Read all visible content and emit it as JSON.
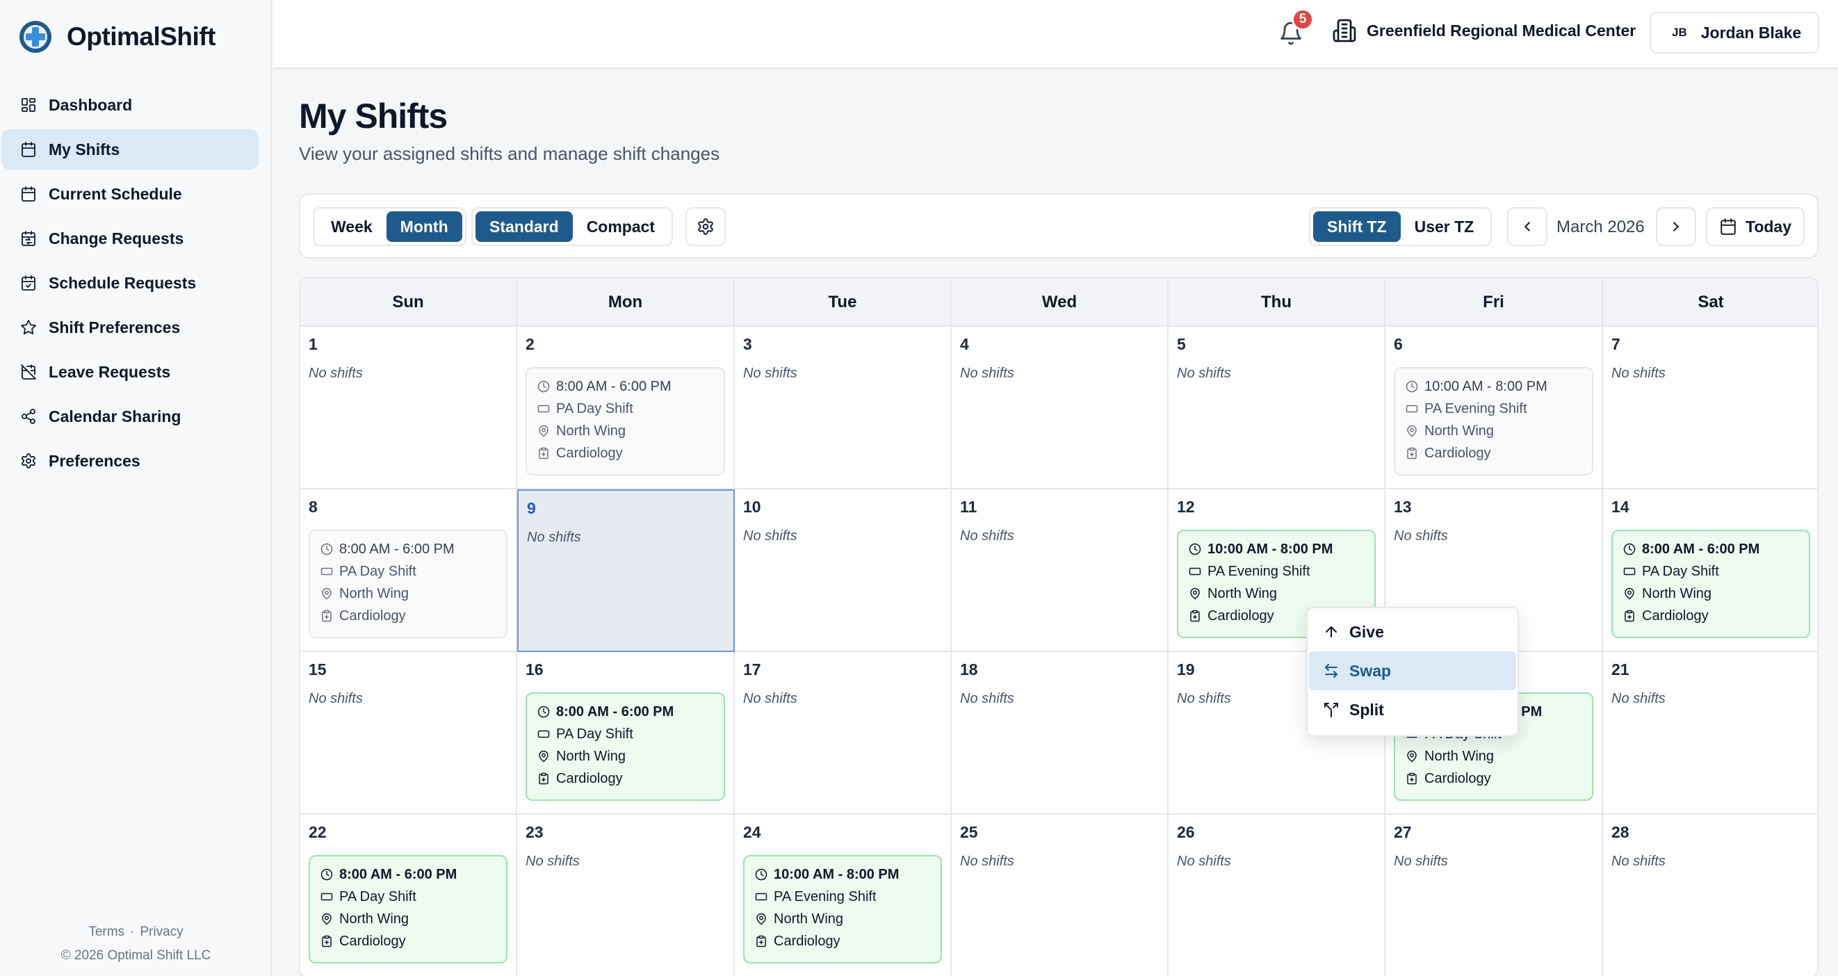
{
  "app": {
    "name": "OptimalShift"
  },
  "colors": {
    "accent": "#1f5a8c",
    "badge": "#e04545",
    "future_shift_bg": "#edfbf0",
    "future_shift_border": "#9ee2b0",
    "today_bg": "#e6ebf3"
  },
  "sidebar": {
    "items": [
      {
        "label": "Dashboard",
        "icon": "dashboard-icon",
        "active": false
      },
      {
        "label": "My Shifts",
        "icon": "calendar-icon",
        "active": true
      },
      {
        "label": "Current Schedule",
        "icon": "calendar-icon",
        "active": false
      },
      {
        "label": "Change Requests",
        "icon": "calendar-swap-icon",
        "active": false
      },
      {
        "label": "Schedule Requests",
        "icon": "calendar-check-icon",
        "active": false
      },
      {
        "label": "Shift Preferences",
        "icon": "star-icon",
        "active": false
      },
      {
        "label": "Leave Requests",
        "icon": "calendar-off-icon",
        "active": false
      },
      {
        "label": "Calendar Sharing",
        "icon": "share-icon",
        "active": false
      },
      {
        "label": "Preferences",
        "icon": "gear-icon",
        "active": false
      }
    ],
    "footer": {
      "terms": "Terms",
      "privacy": "Privacy",
      "separator": "·",
      "copyright": "© 2026 Optimal Shift LLC"
    }
  },
  "topbar": {
    "notifications": "5",
    "organization": "Greenfield Regional Medical Center",
    "user": {
      "initials": "JB",
      "name": "Jordan Blake"
    }
  },
  "header": {
    "title": "My Shifts",
    "subtitle": "View your assigned shifts and manage shift changes"
  },
  "toolbar": {
    "view_options": [
      {
        "label": "Week",
        "on": false
      },
      {
        "label": "Month",
        "on": true
      }
    ],
    "density_options": [
      {
        "label": "Standard",
        "on": true
      },
      {
        "label": "Compact",
        "on": false
      }
    ],
    "tz_options": [
      {
        "label": "Shift TZ",
        "on": true
      },
      {
        "label": "User TZ",
        "on": false
      }
    ],
    "month": "March 2026",
    "today": "Today"
  },
  "calendar": {
    "weekdays": [
      "Sun",
      "Mon",
      "Tue",
      "Wed",
      "Thu",
      "Fri",
      "Sat"
    ],
    "no_shifts": "No shifts",
    "today": 9,
    "shifts": {
      "2": {
        "time": "8:00 AM - 6:00 PM",
        "name": "PA Day Shift",
        "location": "North Wing",
        "department": "Cardiology",
        "status": "past"
      },
      "6": {
        "time": "10:00 AM - 8:00 PM",
        "name": "PA Evening Shift",
        "location": "North Wing",
        "department": "Cardiology",
        "status": "past"
      },
      "8": {
        "time": "8:00 AM - 6:00 PM",
        "name": "PA Day Shift",
        "location": "North Wing",
        "department": "Cardiology",
        "status": "past"
      },
      "12": {
        "time": "10:00 AM - 8:00 PM",
        "name": "PA Evening Shift",
        "location": "North Wing",
        "department": "Cardiology",
        "status": "future"
      },
      "14": {
        "time": "8:00 AM - 6:00 PM",
        "name": "PA Day Shift",
        "location": "North Wing",
        "department": "Cardiology",
        "status": "future"
      },
      "16": {
        "time": "8:00 AM - 6:00 PM",
        "name": "PA Day Shift",
        "location": "North Wing",
        "department": "Cardiology",
        "status": "future"
      },
      "20": {
        "time": "8:00 AM - 6:00 PM",
        "name": "PA Day Shift",
        "location": "North Wing",
        "department": "Cardiology",
        "status": "future"
      },
      "22": {
        "time": "8:00 AM - 6:00 PM",
        "name": "PA Day Shift",
        "location": "North Wing",
        "department": "Cardiology",
        "status": "future"
      },
      "24": {
        "time": "10:00 AM - 8:00 PM",
        "name": "PA Evening Shift",
        "location": "North Wing",
        "department": "Cardiology",
        "status": "future"
      }
    }
  },
  "context_menu": {
    "items": [
      {
        "label": "Give",
        "icon": "arrow-up-icon",
        "highlighted": false
      },
      {
        "label": "Swap",
        "icon": "swap-icon",
        "highlighted": true
      },
      {
        "label": "Split",
        "icon": "split-icon",
        "highlighted": false
      }
    ]
  }
}
